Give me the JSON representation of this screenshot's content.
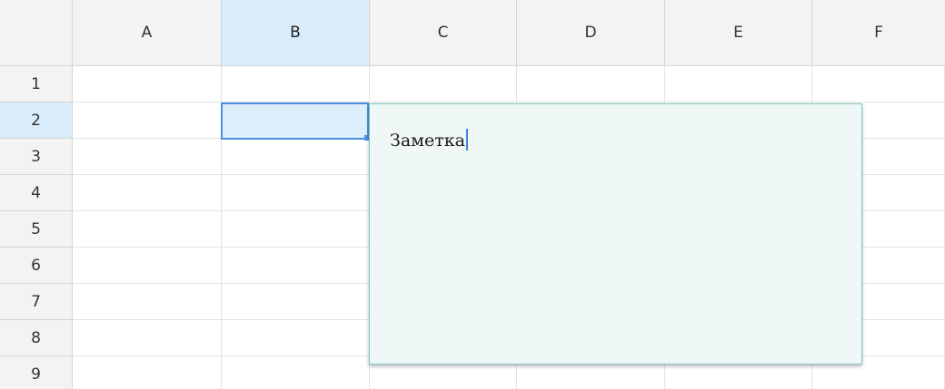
{
  "columns": [
    "A",
    "B",
    "C",
    "D",
    "E",
    "F"
  ],
  "rows": [
    "1",
    "2",
    "3",
    "4",
    "5",
    "6",
    "7",
    "8",
    "9"
  ],
  "selected_column": "B",
  "selected_row": "2",
  "note": {
    "text": "Заметка"
  },
  "colors": {
    "header_bg": "#f3f3f3",
    "selection_bg": "#d9ecfb",
    "selection_border": "#4d90de",
    "note_bg": "#eff8f6",
    "note_border": "#7fc9bf",
    "caret": "#3b86d8"
  }
}
